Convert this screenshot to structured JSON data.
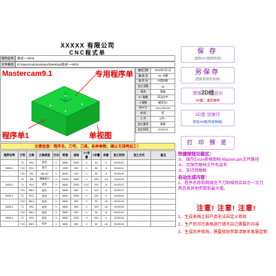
{
  "sheet": {
    "company": "XXXXX  有限公司",
    "title": "CNC程式单",
    "drawing_label": "图档名称",
    "drawing_value": "款式一-MC9",
    "path_label": "文件路径",
    "path_value": "D:\\Users\\Administrator\\Desktop\\款式一-MC9"
  },
  "annotations": {
    "mastercam": "Mastercam9.1",
    "special": "专用程序单",
    "prog1": "程序单1",
    "single": "单视图"
  },
  "info": [
    {
      "k": "编程日期",
      "v": "2025年3月1日"
    },
    {
      "k": "编 程 员",
      "v": "MC 刘建"
    },
    {
      "k": "操 作 员",
      "v": "印度阿斯"
    },
    {
      "k": "加工设备",
      "v": "3#"
    },
    {
      "k": "装夹",
      "v": "批量"
    },
    {
      "k": "XY 碰数",
      "v": "四边分中"
    },
    {
      "k": "Z 碰数",
      "v": "碰顶为0"
    },
    {
      "k": "料尺寸",
      "v": "100×100×50"
    },
    {
      "k": "材  料",
      "v": "铝"
    },
    {
      "k": "工  件",
      "v": "工件一"
    },
    {
      "k": "加工要求",
      "v": "批量"
    },
    {
      "k": "加工时间",
      "v": "15:55:33"
    }
  ],
  "notice": "注意检查：程序名、刀号、刀具、各种参数，确认无误再加工！",
  "tool_table": {
    "headers": [
      "程序名称",
      "刀号",
      "刀具",
      "刀具类型",
      "刃长",
      "转速",
      "进给",
      "XY余量",
      "Z余量",
      "深度",
      "加工时间",
      "加工方式",
      "备注"
    ],
    "rows": [
      [
        "",
        "T1",
        "Φ12",
        "钻头",
        "0",
        "6500",
        "2000",
        "0",
        "50",
        "0",
        "00:00:52",
        "",
        ""
      ],
      [
        "0000-1",
        "T15",
        "Φ12",
        "铣刀",
        "0",
        "1000",
        "300",
        "0",
        "50",
        "-5",
        "00:00:01",
        "",
        ""
      ],
      [
        "",
        "T15",
        "Φ6",
        "M6-1D",
        "0",
        "6000",
        "300",
        "0",
        "50",
        "-8",
        "00:00:00",
        "",
        ""
      ],
      [
        "",
        "T2",
        "Φ8",
        "精度铣刀",
        "0",
        "10000",
        "3000",
        "0",
        "100",
        "-1.6",
        "00:00:04",
        "",
        ""
      ],
      [
        "0000-2",
        "T1",
        "Φ12",
        "钻头",
        "0",
        "6500",
        "2000",
        "0.07",
        "100",
        "-8",
        "00:00:07",
        "",
        ""
      ],
      [
        "",
        "T15",
        "Φ6.5",
        "钻头",
        "0",
        "5500",
        "800",
        "0",
        "100",
        "-8",
        "00:00:21",
        "",
        ""
      ],
      [
        "0000-3",
        "T1",
        "Φ12",
        "钻头",
        "0",
        "6500",
        "2000",
        "0",
        "100",
        "0",
        "00:00:00",
        "",
        ""
      ],
      [
        "",
        "T15",
        "Φ6.5",
        "钻头",
        "0",
        "6500",
        "800",
        "0",
        "50",
        "-10",
        "00:00:10",
        "",
        ""
      ],
      [
        "0000-4",
        "T1",
        "Φ12",
        "钻头",
        "0",
        "6500",
        "800",
        "0",
        "100",
        "-10",
        "00:00:05",
        "",
        ""
      ],
      [
        "",
        "T15",
        "Φ6.5",
        "钻头",
        "0",
        "6500",
        "800",
        "0",
        "50",
        "-8",
        "00:00:10",
        "",
        ""
      ],
      [
        "0000-5",
        "T1",
        "Φ12",
        "钻头",
        "0",
        "6500",
        "1000",
        "0",
        "100",
        "0",
        "00:00:04",
        "",
        ""
      ],
      [
        "",
        "T15",
        "Φ6.5",
        "钻头",
        "0",
        "5500",
        "800",
        "0",
        "50",
        "-10",
        "00:00:35",
        "",
        ""
      ]
    ]
  },
  "side": {
    "btn1_title": "保 存",
    "btn1_sub": "(面板MC图档目录)",
    "btn2_title": "另保存",
    "btn2_sub": "(面板到其他目录)",
    "btn3_pre": "增强",
    "btn3_bold": "2D线",
    "btn3_post": "显示",
    "btn3_sub": "3D面、速度缓和",
    "btn4_title": "3D面 误操作",
    "btn4_sub": "恢复3D面(恢复数据)",
    "btn5_title": "打 印 预 览"
  },
  "help": {
    "heading1": "快捷按钮功能区：",
    "item1": "①、保存Excel表格图档 Mastercam文件路径",
    "item2": "②、另保存图档文件名会名",
    "item3": "③、支持到图框",
    "heading2": "自动生成内容：",
    "item4": "1、程序名称和网填充下刀和相同且显示一次刀",
    "item5": "具信息其他参数取最大值。",
    "warning": "注意!  注意!  注意!",
    "rule1": "1、生成表格之前产品无法自定义修改",
    "rule2": "2、生产后可在表格进行填写自己需要的内容",
    "rule3": "3、生成后并修改，需要修改参数请联系客服定制"
  },
  "colors": {
    "accent": "#a24bc8",
    "warning": "#e10000",
    "notice_bg": "#fff27a",
    "box_top": "#19d33c",
    "box_side": "#0fa52a"
  }
}
